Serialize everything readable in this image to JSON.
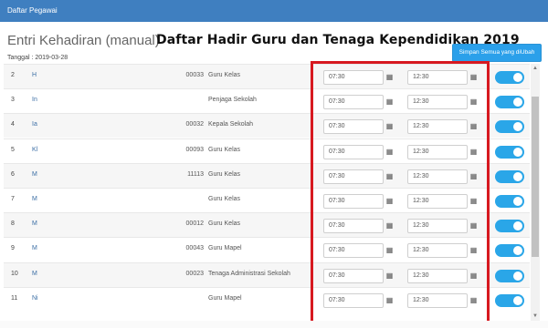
{
  "header": {
    "title": "Daftar Pegawai"
  },
  "page": {
    "subtitle": "Entri Kehadiran (manual)",
    "overlay_title": "Daftar Hadir Guru dan Tenaga Kependidikan 2019",
    "date_label": "Tanggal : 2019-03-28",
    "save_button": "Simpan Semua yang diUbah"
  },
  "icons": {
    "clock": "clock-icon",
    "toggle": "toggle-switch"
  },
  "colors": {
    "accent": "#2aa6e8",
    "highlight": "#d71920",
    "header": "#3f7fc0"
  },
  "rows": [
    {
      "no": "2",
      "name": "H",
      "id": "00033",
      "jabatan": "Guru Kelas",
      "in": "07:30",
      "out": "12:30",
      "active": true
    },
    {
      "no": "3",
      "name": "In",
      "id": "",
      "jabatan": "Penjaga Sekolah",
      "in": "07:30",
      "out": "12:30",
      "active": true
    },
    {
      "no": "4",
      "name": "Ia",
      "id": "00032",
      "jabatan": "Kepala Sekolah",
      "in": "07:30",
      "out": "12:30",
      "active": true
    },
    {
      "no": "5",
      "name": "Kl",
      "id": "00093",
      "jabatan": "Guru Kelas",
      "in": "07:30",
      "out": "12:30",
      "active": true
    },
    {
      "no": "6",
      "name": "M",
      "id": "11113",
      "jabatan": "Guru Kelas",
      "in": "07:30",
      "out": "12:30",
      "active": true
    },
    {
      "no": "7",
      "name": "M",
      "id": "",
      "jabatan": "Guru Kelas",
      "in": "07:30",
      "out": "12:30",
      "active": true
    },
    {
      "no": "8",
      "name": "M",
      "id": "00012",
      "jabatan": "Guru Kelas",
      "in": "07:30",
      "out": "12:30",
      "active": true
    },
    {
      "no": "9",
      "name": "M",
      "id": "00043",
      "jabatan": "Guru Mapel",
      "in": "07:30",
      "out": "12:30",
      "active": true
    },
    {
      "no": "10",
      "name": "M",
      "id": "00023",
      "jabatan": "Tenaga Administrasi Sekolah",
      "in": "07:30",
      "out": "12:30",
      "active": true
    },
    {
      "no": "11",
      "name": "Ni",
      "id": "",
      "jabatan": "Guru Mapel",
      "in": "07:30",
      "out": "12:30",
      "active": true
    }
  ]
}
